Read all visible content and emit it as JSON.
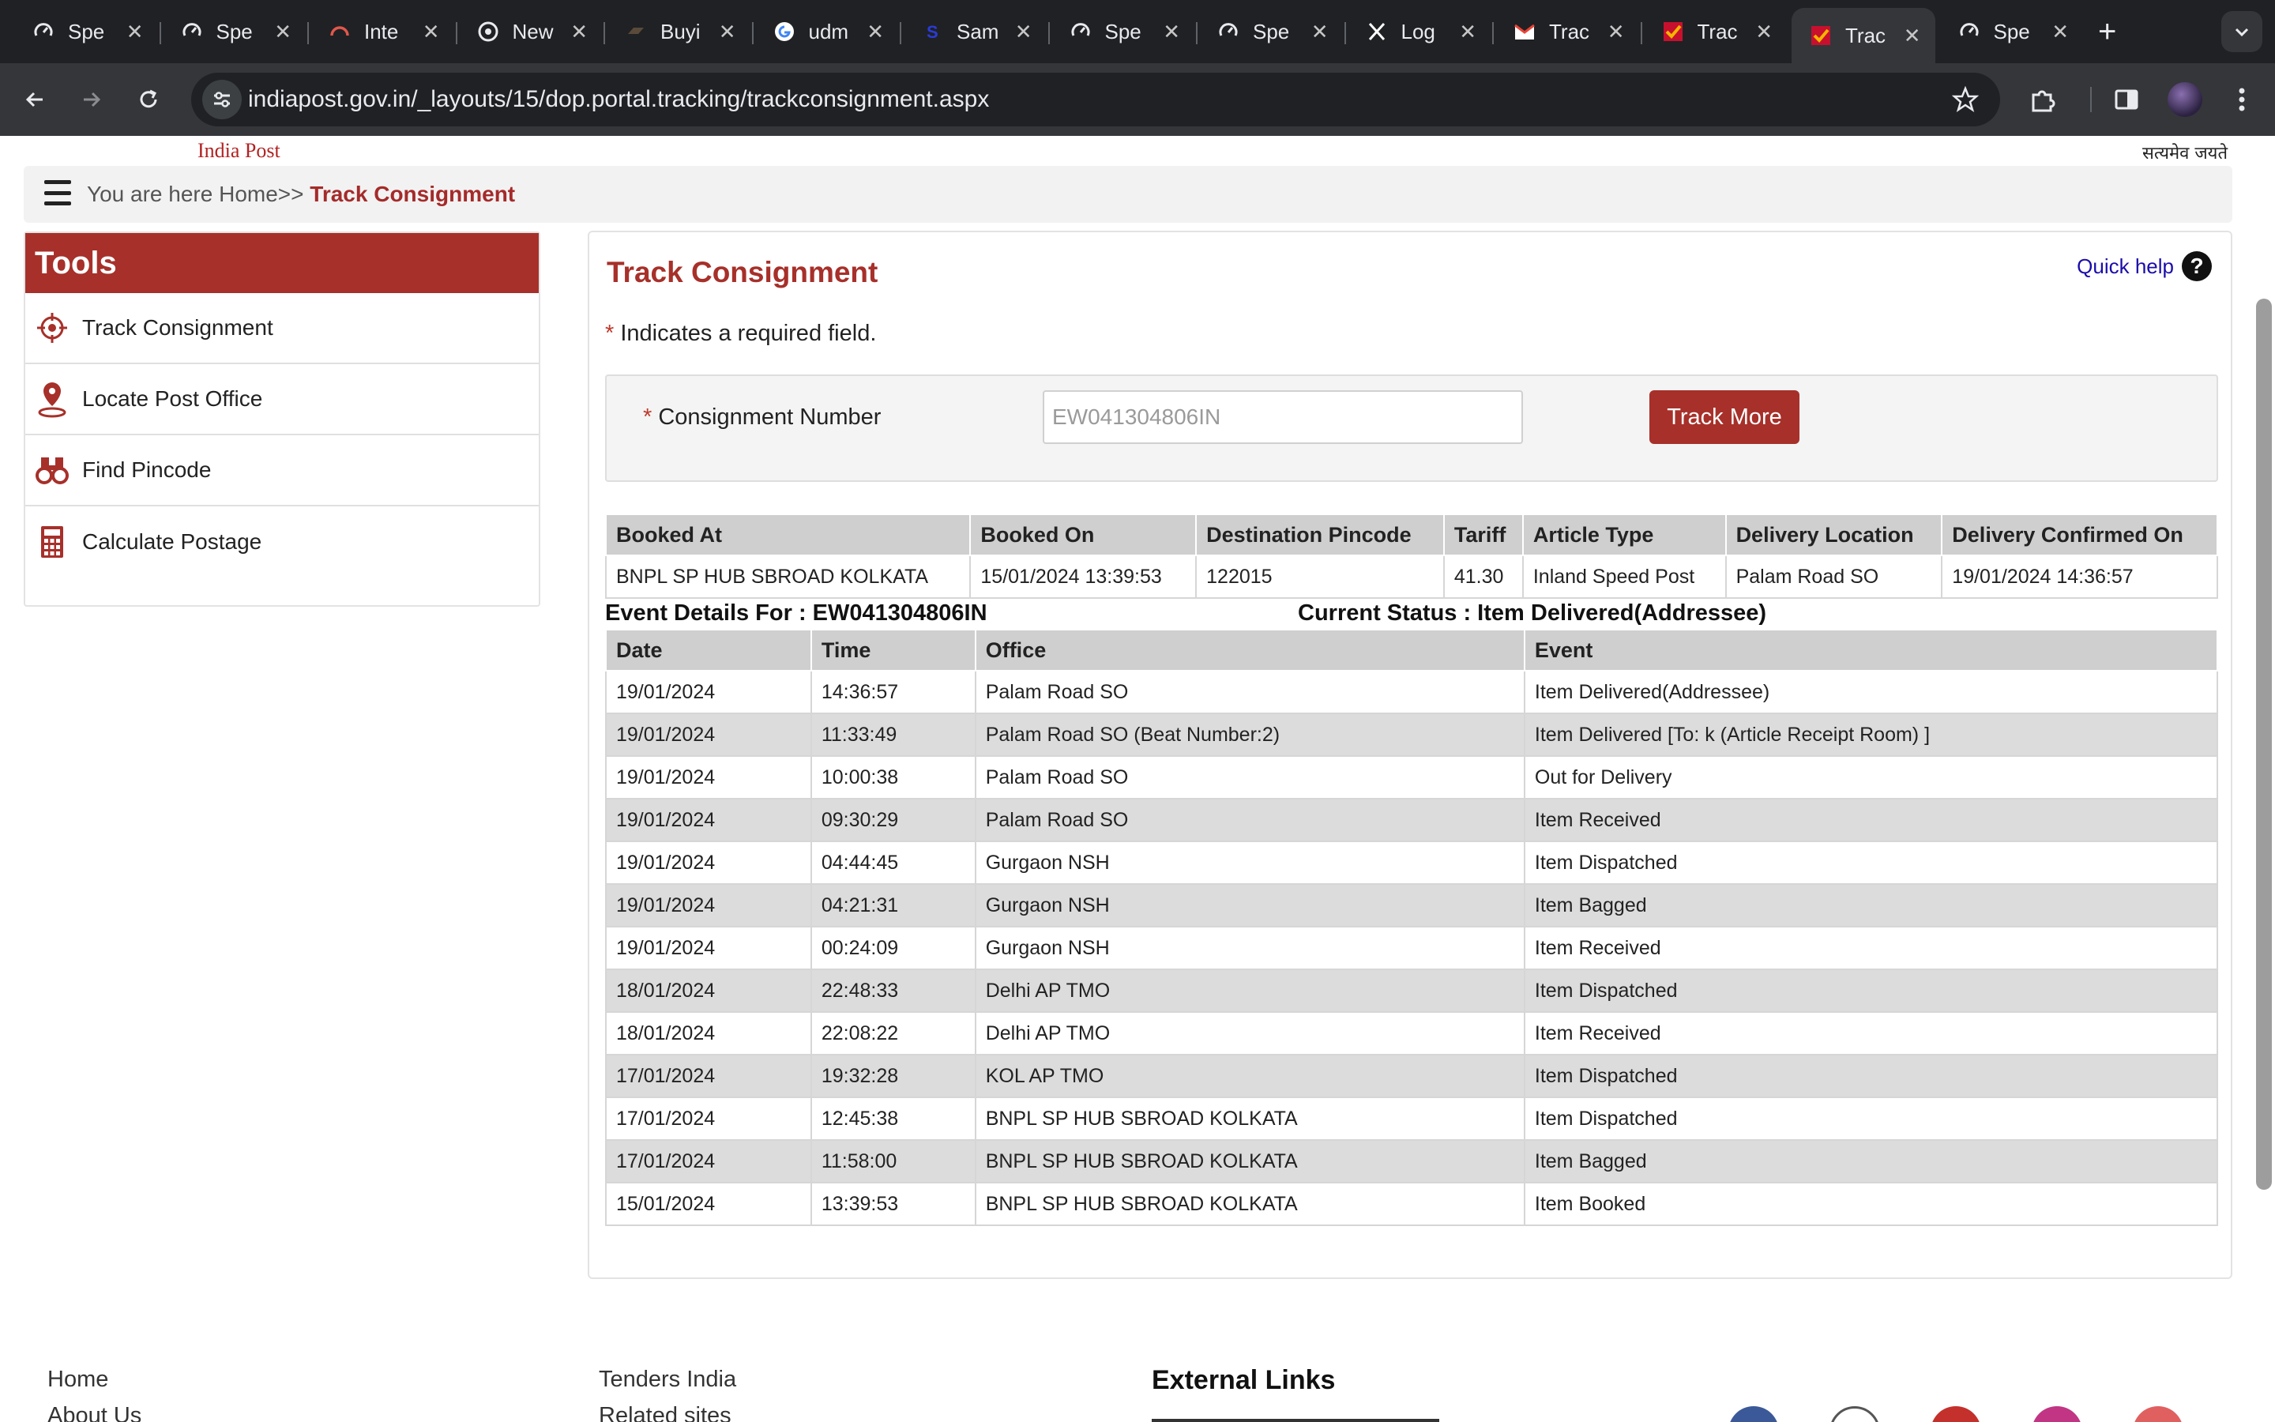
{
  "browser": {
    "tabs": [
      {
        "label": "Spe",
        "icon": "speedtest-icon"
      },
      {
        "label": "Spe",
        "icon": "speedtest-icon"
      },
      {
        "label": "Inte",
        "icon": "gauge-icon"
      },
      {
        "label": "New",
        "icon": "chrome-icon"
      },
      {
        "label": "Buyi",
        "icon": "shop-icon"
      },
      {
        "label": "udm",
        "icon": "google-icon"
      },
      {
        "label": "Sam",
        "icon": "s-logo-icon"
      },
      {
        "label": "Spe",
        "icon": "speedtest-icon"
      },
      {
        "label": "Spe",
        "icon": "speedtest-icon"
      },
      {
        "label": "Log",
        "icon": "x-logo-icon"
      },
      {
        "label": "Trac",
        "icon": "gmail-icon"
      },
      {
        "label": "Trac",
        "icon": "indiapost-icon"
      },
      {
        "label": "Trac",
        "icon": "indiapost-icon",
        "active": true
      },
      {
        "label": "Spe",
        "icon": "speedtest-icon"
      }
    ],
    "url": "indiapost.gov.in/_layouts/15/dop.portal.tracking/trackconsignment.aspx"
  },
  "header": {
    "logo_text": "India Post",
    "emblem_text": "सत्यमेव जयते"
  },
  "breadcrumb": {
    "prefix": "You are here Home>> ",
    "current": "Track Consignment"
  },
  "sidebar": {
    "title": "Tools",
    "items": [
      {
        "label": "Track Consignment",
        "icon": "target-icon"
      },
      {
        "label": "Locate Post Office",
        "icon": "location-pin-icon"
      },
      {
        "label": "Find Pincode",
        "icon": "binoculars-icon"
      },
      {
        "label": "Calculate Postage",
        "icon": "calculator-icon"
      }
    ]
  },
  "main": {
    "title": "Track Consignment",
    "quick_help": "Quick help",
    "required_star": "*",
    "required_note": " Indicates a required field.",
    "form": {
      "label": "Consignment Number",
      "value": "EW041304806IN",
      "button": "Track More"
    },
    "booking": {
      "headers": [
        "Booked At",
        "Booked On",
        "Destination Pincode",
        "Tariff",
        "Article Type",
        "Delivery Location",
        "Delivery Confirmed On"
      ],
      "row": [
        "BNPL SP HUB SBROAD KOLKATA",
        "15/01/2024 13:39:53",
        "122015",
        "41.30",
        "Inland Speed Post",
        "Palam Road SO",
        "19/01/2024 14:36:57"
      ]
    },
    "event_details_label": "Event Details For : EW041304806IN",
    "current_status_label": "Current Status : Item Delivered(Addressee)",
    "events": {
      "headers": [
        "Date",
        "Time",
        "Office",
        "Event"
      ],
      "rows": [
        [
          "19/01/2024",
          "14:36:57",
          "Palam Road SO",
          "Item Delivered(Addressee)"
        ],
        [
          "19/01/2024",
          "11:33:49",
          "Palam Road SO (Beat Number:2)",
          "Item Delivered [To: k (Article Receipt Room) ]"
        ],
        [
          "19/01/2024",
          "10:00:38",
          "Palam Road SO",
          "Out for Delivery"
        ],
        [
          "19/01/2024",
          "09:30:29",
          "Palam Road SO",
          "Item Received"
        ],
        [
          "19/01/2024",
          "04:44:45",
          "Gurgaon NSH",
          "Item Dispatched"
        ],
        [
          "19/01/2024",
          "04:21:31",
          "Gurgaon NSH",
          "Item Bagged"
        ],
        [
          "19/01/2024",
          "00:24:09",
          "Gurgaon NSH",
          "Item Received"
        ],
        [
          "18/01/2024",
          "22:48:33",
          "Delhi AP TMO",
          "Item Dispatched"
        ],
        [
          "18/01/2024",
          "22:08:22",
          "Delhi AP TMO",
          "Item Received"
        ],
        [
          "17/01/2024",
          "19:32:28",
          "KOL AP TMO",
          "Item Dispatched"
        ],
        [
          "17/01/2024",
          "12:45:38",
          "BNPL SP HUB SBROAD KOLKATA",
          "Item Dispatched"
        ],
        [
          "17/01/2024",
          "11:58:00",
          "BNPL SP HUB SBROAD KOLKATA",
          "Item Bagged"
        ],
        [
          "15/01/2024",
          "13:39:53",
          "BNPL SP HUB SBROAD KOLKATA",
          "Item Booked"
        ]
      ]
    }
  },
  "footer": {
    "links_col1": [
      "Home",
      "About Us"
    ],
    "links_col2": [
      "Tenders India",
      "Related sites"
    ],
    "external_title": "External Links",
    "social": [
      {
        "icon": "facebook-icon",
        "color": "#3b5998"
      },
      {
        "icon": "twitter-icon",
        "color": "#ffffff"
      },
      {
        "icon": "youtube-icon",
        "color": "#c4302b"
      },
      {
        "icon": "instagram-icon",
        "color": "#c13584"
      },
      {
        "icon": "pinterest-icon",
        "color": "#e06060"
      }
    ]
  },
  "colors": {
    "brand_red": "#a7302a",
    "chrome_dark": "#202124",
    "chrome_toolbar": "#35363a"
  }
}
